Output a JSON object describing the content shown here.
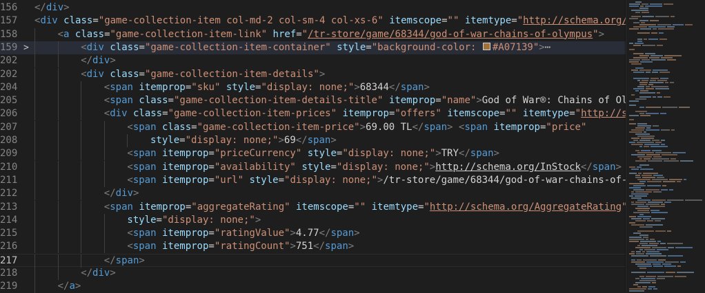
{
  "accent_swatch_color": "#A07139",
  "lines": [
    {
      "num": "156",
      "indent": 0,
      "tokens": [
        [
          "tg",
          "</"
        ],
        [
          "tn",
          "div"
        ],
        [
          "tg",
          ">"
        ]
      ]
    },
    {
      "num": "157",
      "indent": 0,
      "tokens": [
        [
          "tg",
          "<"
        ],
        [
          "tn",
          "div"
        ],
        [
          "tx",
          " "
        ],
        [
          "at",
          "class"
        ],
        [
          "tx",
          "="
        ],
        [
          "st",
          "\"game-collection-item col-md-2 col-sm-4 col-xs-6\""
        ],
        [
          "tx",
          " "
        ],
        [
          "at",
          "itemscope"
        ],
        [
          "tx",
          "="
        ],
        [
          "st",
          "\"\""
        ],
        [
          "tx",
          " "
        ],
        [
          "at",
          "itemtype"
        ],
        [
          "tx",
          "="
        ],
        [
          "st",
          "\""
        ],
        [
          "lk",
          "http://schema.org/"
        ]
      ]
    },
    {
      "num": "158",
      "indent": 1,
      "tokens": [
        [
          "tg",
          "<"
        ],
        [
          "tn",
          "a"
        ],
        [
          "tx",
          " "
        ],
        [
          "at",
          "class"
        ],
        [
          "tx",
          "="
        ],
        [
          "st",
          "\"game-collection-item-link\""
        ],
        [
          "tx",
          " "
        ],
        [
          "at",
          "href"
        ],
        [
          "tx",
          "="
        ],
        [
          "st",
          "\""
        ],
        [
          "lk",
          "/tr-store/game/68344/god-of-war-chains-of-olympus"
        ],
        [
          "st",
          "\""
        ],
        [
          "tg",
          ">"
        ]
      ]
    },
    {
      "num": "159",
      "indent": 2,
      "fold": ">",
      "highlight": true,
      "tokens": [
        [
          "tg",
          "<"
        ],
        [
          "tn",
          "div"
        ],
        [
          "tx",
          " "
        ],
        [
          "at",
          "class"
        ],
        [
          "tx",
          "="
        ],
        [
          "st",
          "\"game-collection-item-container\""
        ],
        [
          "tx",
          " "
        ],
        [
          "at",
          "style"
        ],
        [
          "tx",
          "="
        ],
        [
          "st",
          "\"background-color: "
        ],
        [
          "swatch",
          ""
        ],
        [
          "st",
          "#A07139\""
        ],
        [
          "tg",
          ">"
        ],
        [
          "ell",
          "⋯"
        ]
      ]
    },
    {
      "num": "202",
      "indent": 2,
      "tokens": [
        [
          "tg",
          "</"
        ],
        [
          "tn",
          "div"
        ],
        [
          "tg",
          ">"
        ]
      ]
    },
    {
      "num": "202",
      "indent": 2,
      "tokens": [
        [
          "tg",
          "<"
        ],
        [
          "tn",
          "div"
        ],
        [
          "tx",
          " "
        ],
        [
          "at",
          "class"
        ],
        [
          "tx",
          "="
        ],
        [
          "st",
          "\"game-collection-item-details\""
        ],
        [
          "tg",
          ">"
        ]
      ]
    },
    {
      "num": "204",
      "indent": 3,
      "tokens": [
        [
          "tg",
          "<"
        ],
        [
          "tn",
          "span"
        ],
        [
          "tx",
          " "
        ],
        [
          "at",
          "itemprop"
        ],
        [
          "tx",
          "="
        ],
        [
          "st",
          "\"sku\""
        ],
        [
          "tx",
          " "
        ],
        [
          "at",
          "style"
        ],
        [
          "tx",
          "="
        ],
        [
          "st",
          "\"display: none;\""
        ],
        [
          "tg",
          ">"
        ],
        [
          "tx",
          "68344"
        ],
        [
          "tg",
          "</"
        ],
        [
          "tn",
          "span"
        ],
        [
          "tg",
          ">"
        ]
      ]
    },
    {
      "num": "205",
      "indent": 3,
      "tokens": [
        [
          "tg",
          "<"
        ],
        [
          "tn",
          "span"
        ],
        [
          "tx",
          " "
        ],
        [
          "at",
          "class"
        ],
        [
          "tx",
          "="
        ],
        [
          "st",
          "\"game-collection-item-details-title\""
        ],
        [
          "tx",
          " "
        ],
        [
          "at",
          "itemprop"
        ],
        [
          "tx",
          "="
        ],
        [
          "st",
          "\"name\""
        ],
        [
          "tg",
          ">"
        ],
        [
          "tx",
          "God of War®: Chains of Ol"
        ]
      ]
    },
    {
      "num": "206",
      "indent": 3,
      "tokens": [
        [
          "tg",
          "<"
        ],
        [
          "tn",
          "div"
        ],
        [
          "tx",
          " "
        ],
        [
          "at",
          "class"
        ],
        [
          "tx",
          "="
        ],
        [
          "st",
          "\"game-collection-item-prices\""
        ],
        [
          "tx",
          " "
        ],
        [
          "at",
          "itemprop"
        ],
        [
          "tx",
          "="
        ],
        [
          "st",
          "\"offers\""
        ],
        [
          "tx",
          " "
        ],
        [
          "at",
          "itemscope"
        ],
        [
          "tx",
          "="
        ],
        [
          "st",
          "\"\""
        ],
        [
          "tx",
          " "
        ],
        [
          "at",
          "itemtype"
        ],
        [
          "tx",
          "="
        ],
        [
          "st",
          "\""
        ],
        [
          "lk",
          "http://s"
        ]
      ]
    },
    {
      "num": "207",
      "indent": 4,
      "tokens": [
        [
          "tg",
          "<"
        ],
        [
          "tn",
          "span"
        ],
        [
          "tx",
          " "
        ],
        [
          "at",
          "class"
        ],
        [
          "tx",
          "="
        ],
        [
          "st",
          "\"game-collection-item-price\""
        ],
        [
          "tg",
          ">"
        ],
        [
          "tx",
          "69.00 TL"
        ],
        [
          "tg",
          "</"
        ],
        [
          "tn",
          "span"
        ],
        [
          "tg",
          ">"
        ],
        [
          "tx",
          " "
        ],
        [
          "tg",
          "<"
        ],
        [
          "tn",
          "span"
        ],
        [
          "tx",
          " "
        ],
        [
          "at",
          "itemprop"
        ],
        [
          "tx",
          "="
        ],
        [
          "st",
          "\"price\""
        ]
      ]
    },
    {
      "num": "208",
      "indent": 5,
      "tokens": [
        [
          "at",
          "style"
        ],
        [
          "tx",
          "="
        ],
        [
          "st",
          "\"display: none;\""
        ],
        [
          "tg",
          ">"
        ],
        [
          "tx",
          "69"
        ],
        [
          "tg",
          "</"
        ],
        [
          "tn",
          "span"
        ],
        [
          "tg",
          ">"
        ]
      ]
    },
    {
      "num": "209",
      "indent": 4,
      "tokens": [
        [
          "tg",
          "<"
        ],
        [
          "tn",
          "span"
        ],
        [
          "tx",
          " "
        ],
        [
          "at",
          "itemprop"
        ],
        [
          "tx",
          "="
        ],
        [
          "st",
          "\"priceCurrency\""
        ],
        [
          "tx",
          " "
        ],
        [
          "at",
          "style"
        ],
        [
          "tx",
          "="
        ],
        [
          "st",
          "\"display: none;\""
        ],
        [
          "tg",
          ">"
        ],
        [
          "tx",
          "TRY"
        ],
        [
          "tg",
          "</"
        ],
        [
          "tn",
          "span"
        ],
        [
          "tg",
          ">"
        ]
      ]
    },
    {
      "num": "210",
      "indent": 4,
      "tokens": [
        [
          "tg",
          "<"
        ],
        [
          "tn",
          "span"
        ],
        [
          "tx",
          " "
        ],
        [
          "at",
          "itemprop"
        ],
        [
          "tx",
          "="
        ],
        [
          "st",
          "\"availability\""
        ],
        [
          "tx",
          " "
        ],
        [
          "at",
          "style"
        ],
        [
          "tx",
          "="
        ],
        [
          "st",
          "\"display: none;\""
        ],
        [
          "tg",
          ">"
        ],
        [
          "lk2",
          "http://schema.org/InStock"
        ],
        [
          "tg",
          "</"
        ],
        [
          "tn",
          "span"
        ],
        [
          "tg",
          ">"
        ]
      ]
    },
    {
      "num": "211",
      "indent": 4,
      "tokens": [
        [
          "tg",
          "<"
        ],
        [
          "tn",
          "span"
        ],
        [
          "tx",
          " "
        ],
        [
          "at",
          "itemprop"
        ],
        [
          "tx",
          "="
        ],
        [
          "st",
          "\"url\""
        ],
        [
          "tx",
          " "
        ],
        [
          "at",
          "style"
        ],
        [
          "tx",
          "="
        ],
        [
          "st",
          "\"display: none;\""
        ],
        [
          "tg",
          ">"
        ],
        [
          "tx",
          "/tr-store/game/68344/god-of-war-chains-of-"
        ]
      ]
    },
    {
      "num": "212",
      "indent": 3,
      "tokens": [
        [
          "tg",
          "</"
        ],
        [
          "tn",
          "div"
        ],
        [
          "tg",
          ">"
        ]
      ]
    },
    {
      "num": "213",
      "indent": 3,
      "tokens": [
        [
          "tg",
          "<"
        ],
        [
          "tn",
          "span"
        ],
        [
          "tx",
          " "
        ],
        [
          "at",
          "itemprop"
        ],
        [
          "tx",
          "="
        ],
        [
          "st",
          "\"aggregateRating\""
        ],
        [
          "tx",
          " "
        ],
        [
          "at",
          "itemscope"
        ],
        [
          "tx",
          "="
        ],
        [
          "st",
          "\"\""
        ],
        [
          "tx",
          " "
        ],
        [
          "at",
          "itemtype"
        ],
        [
          "tx",
          "="
        ],
        [
          "st",
          "\""
        ],
        [
          "lk",
          "http://schema.org/AggregateRating"
        ],
        [
          "st",
          "\""
        ]
      ]
    },
    {
      "num": "214",
      "indent": 4,
      "tokens": [
        [
          "at",
          "style"
        ],
        [
          "tx",
          "="
        ],
        [
          "st",
          "\"display: none;\""
        ],
        [
          "tg",
          ">"
        ]
      ]
    },
    {
      "num": "215",
      "indent": 4,
      "tokens": [
        [
          "tg",
          "<"
        ],
        [
          "tn",
          "span"
        ],
        [
          "tx",
          " "
        ],
        [
          "at",
          "itemprop"
        ],
        [
          "tx",
          "="
        ],
        [
          "st",
          "\"ratingValue\""
        ],
        [
          "tg",
          ">"
        ],
        [
          "tx",
          "4.77"
        ],
        [
          "tg",
          "</"
        ],
        [
          "tn",
          "span"
        ],
        [
          "tg",
          ">"
        ]
      ]
    },
    {
      "num": "216",
      "indent": 4,
      "tokens": [
        [
          "tg",
          "<"
        ],
        [
          "tn",
          "span"
        ],
        [
          "tx",
          " "
        ],
        [
          "at",
          "itemprop"
        ],
        [
          "tx",
          "="
        ],
        [
          "st",
          "\"ratingCount\""
        ],
        [
          "tg",
          ">"
        ],
        [
          "tx",
          "751"
        ],
        [
          "tg",
          "</"
        ],
        [
          "tn",
          "span"
        ],
        [
          "tg",
          ">"
        ]
      ]
    },
    {
      "num": "217",
      "indent": 3,
      "active": true,
      "current": true,
      "tokens": [
        [
          "tg",
          "</"
        ],
        [
          "tn",
          "span"
        ],
        [
          "tg",
          ">"
        ]
      ]
    },
    {
      "num": "218",
      "indent": 2,
      "tokens": [
        [
          "tg",
          "</"
        ],
        [
          "tn",
          "div"
        ],
        [
          "tg",
          ">"
        ]
      ]
    },
    {
      "num": "219",
      "indent": 1,
      "tokens": [
        [
          "tg",
          "</"
        ],
        [
          "tn",
          "a"
        ],
        [
          "tg",
          ">"
        ]
      ]
    }
  ]
}
